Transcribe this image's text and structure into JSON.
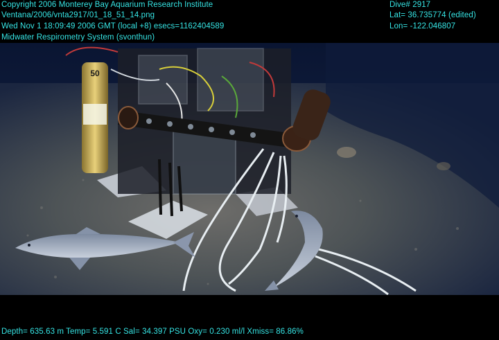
{
  "overlay": {
    "copyright": "Copyright 2006 Monterey Bay Aquarium Research Institute",
    "file_path": "Ventana/2006/vnta2917/01_18_51_14.png",
    "timestamp": "Wed Nov  1 18:09:49 2006 GMT (local +8)  esecs=1162404589",
    "system": "Midwater Respirometry System (svonthun)",
    "dive": "Dive# 2917",
    "lat": "Lat= 36.735774 (edited)",
    "lon": "Lon= -122.046807",
    "telemetry": "Depth= 635.63 m  Temp= 5.591 C  Sal= 34.397 PSU  Oxy= 0.230 ml/l  Xmiss= 86.86%"
  },
  "scene": {
    "apparatus_label": "50",
    "colors": {
      "overlay_text": "#36e6e6",
      "water": "#0b1a3c",
      "seafloor": "#5b5e62",
      "tubing": "#e8eef2",
      "fish": "#9aa6b8"
    }
  }
}
